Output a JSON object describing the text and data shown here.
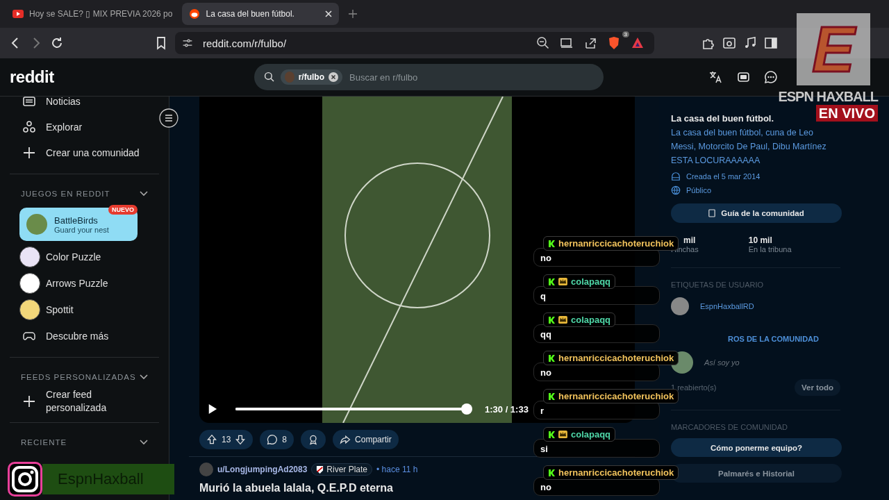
{
  "browser": {
    "tabs": [
      {
        "title": "Hoy se SALE? ▯ MIX PREVIA 2026 po",
        "selected": false
      },
      {
        "title": "La casa del buen fútbol.",
        "selected": true
      }
    ],
    "url": "reddit.com/r/fulbo/",
    "shield_count": "3"
  },
  "header": {
    "logo": "reddit",
    "search_chip": "r/fulbo",
    "search_placeholder": "Buscar en r/fulbo"
  },
  "sidebar": {
    "top_items": [
      "Noticias",
      "Explorar",
      "Crear una comunidad"
    ],
    "games_title": "JUEGOS EN REDDIT",
    "games": [
      {
        "kind": "featured",
        "name": "BattleBirds",
        "subtitle": "Guard your nest",
        "badge": "NUEVO"
      },
      {
        "kind": "game",
        "name": "Color Puzzle",
        "color": "#e9e3f5"
      },
      {
        "kind": "game",
        "name": "Arrows Puzzle",
        "color": "#ffffff"
      },
      {
        "kind": "game",
        "name": "Spottit",
        "color": "#f2d77a"
      },
      {
        "kind": "link",
        "name": "Descubre más"
      }
    ],
    "feeds_title": "FEEDS PERSONALIZADAS",
    "feeds_item": "Crear feed personalizada",
    "recent_title": "RECIENTE"
  },
  "video": {
    "time": "1:30 / 1:33",
    "progress": {
      "level": 0.97
    }
  },
  "post": {
    "votes": "13",
    "comments": "8",
    "share": "Compartir",
    "author": "u/LongjumpingAd2083",
    "flair": "River Plate",
    "age": "• hace 11 h",
    "title": "Murió la abuela lalala, Q.E.P.D eterna"
  },
  "community": {
    "title": "La casa del buen fútbol.",
    "description": "La casa del buen fútbol, cuna de Leo Messi, Motorcito De Paul, Dibu Martínez ESTA LOCURAAAAAA",
    "created": "Creada el 5 mar 2014",
    "visibility": "Público",
    "guide_button": "Guía de la comunidad",
    "stats": [
      {
        "value": "mil",
        "label": "Hinchas"
      },
      {
        "value": "10 mil",
        "label": "En la tribuna"
      }
    ],
    "user_tags_title": "ETIQUETAS DE USUARIO",
    "user_tag": "EspnHaxballRD",
    "achievements_title": "ROS DE LA COMUNIDAD",
    "achievement": "Así soy yo",
    "reopened": "1 reabierto(s)",
    "view_all": "Ver todo",
    "bookmarks_title": "MARCADORES DE COMUNIDAD",
    "bookmarks": [
      "Cómo ponerme equipo?",
      "Palmarés e Historial"
    ]
  },
  "overlay": {
    "logo_letter": "E",
    "brand": "ESPN HAXBALL",
    "live": "EN VIVO",
    "instagram": "EspnHaxball"
  },
  "chat": {
    "messages": [
      {
        "user": "hernanriccicachoteruchiok",
        "color": "#f2c35c",
        "moderator": false,
        "text": "no"
      },
      {
        "user": "colapaqq",
        "color": "#4fd8a8",
        "moderator": true,
        "text": "q"
      },
      {
        "user": "colapaqq",
        "color": "#4fd8a8",
        "moderator": true,
        "text": "qq"
      },
      {
        "user": "hernanriccicachoteruchiok",
        "color": "#f2c35c",
        "moderator": false,
        "text": "no"
      },
      {
        "user": "hernanriccicachoteruchiok",
        "color": "#f2c35c",
        "moderator": false,
        "text": "r"
      },
      {
        "user": "colapaqq",
        "color": "#4fd8a8",
        "moderator": true,
        "text": "si"
      },
      {
        "user": "hernanriccicachoteruchiok",
        "color": "#f2c35c",
        "moderator": false,
        "text": "no"
      }
    ]
  }
}
